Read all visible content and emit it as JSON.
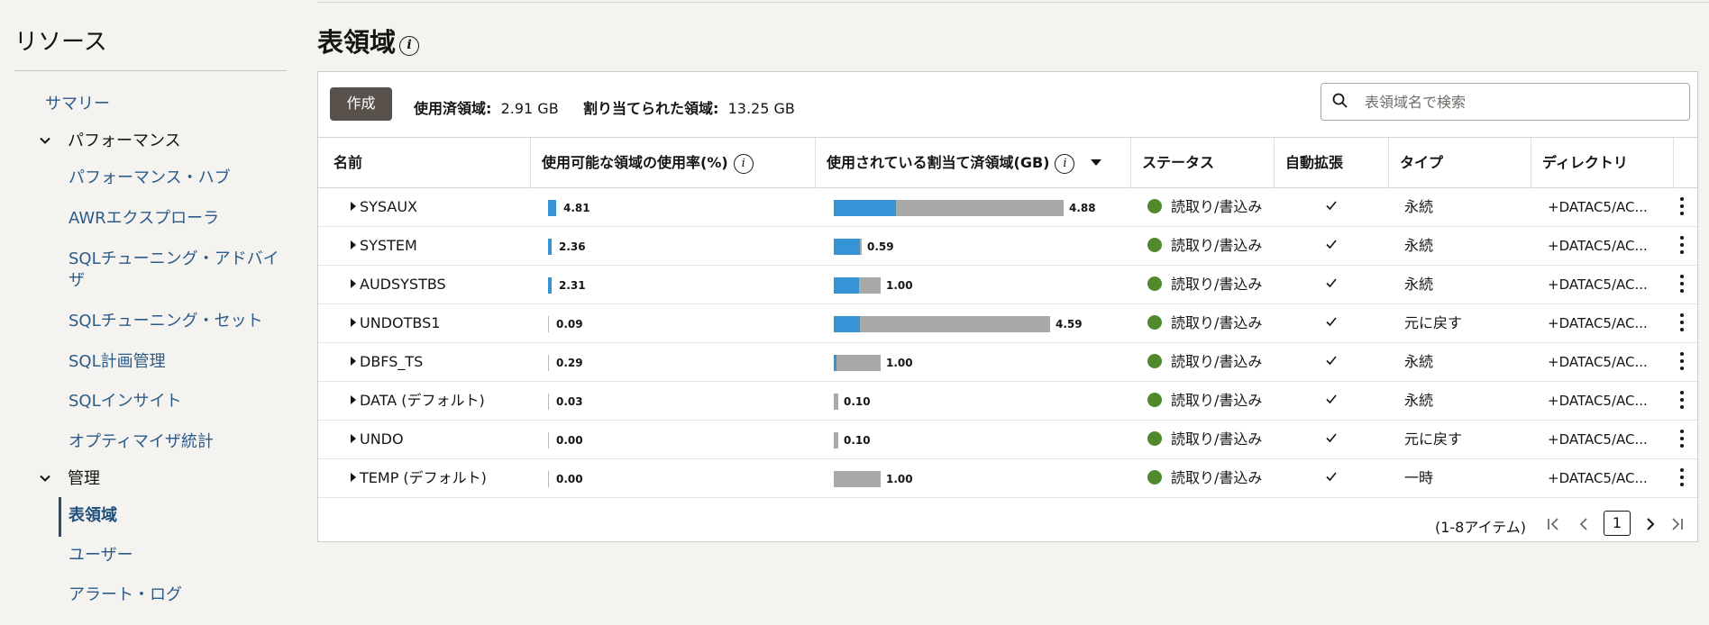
{
  "sidebar": {
    "title": "リソース",
    "items": [
      {
        "label": "サマリー"
      },
      {
        "label": "パフォーマンス"
      },
      {
        "label": "パフォーマンス・ハブ"
      },
      {
        "label": "AWRエクスプローラ"
      },
      {
        "label": "SQLチューニング・アドバイ"
      },
      {
        "label": "ザ"
      },
      {
        "label": "SQLチューニング・セット"
      },
      {
        "label": "SQL計画管理"
      },
      {
        "label": "SQLインサイト"
      },
      {
        "label": "オプティマイザ統計"
      },
      {
        "label": "管理"
      },
      {
        "label": "表領域"
      },
      {
        "label": "ユーザー"
      },
      {
        "label": "アラート・ログ"
      }
    ]
  },
  "page": {
    "title": "表領域",
    "info_glyph": "i"
  },
  "toolbar": {
    "create_label": "作成",
    "used_label": "使用済領域:",
    "used_value": "2.91 GB",
    "allocated_label": "割り当てられた領域:",
    "allocated_value": "13.25 GB",
    "search_placeholder": "表領域名で検索"
  },
  "columns": {
    "name": "名前",
    "usable_pct": "使用可能な領域の使用率(%)",
    "allocated_used": "使用されている割当て済領域(GB)",
    "status": "ステータス",
    "autoextend": "自動拡張",
    "type": "タイプ",
    "directory": "ディレクトリ"
  },
  "rows": [
    {
      "name": "SYSAUX",
      "pct": "4.81",
      "pct_num": 4.81,
      "used": "4.88",
      "used_frac": 0.27,
      "alloc_frac": 1.0,
      "status": "読取り/書込み",
      "type": "永続",
      "dir": "+DATAC5/AC..."
    },
    {
      "name": "SYSTEM",
      "pct": "2.36",
      "pct_num": 2.36,
      "used": "0.59",
      "used_frac": 0.92,
      "alloc_frac": 0.121,
      "status": "読取り/書込み",
      "type": "永続",
      "dir": "+DATAC5/AC..."
    },
    {
      "name": "AUDSYSTBS",
      "pct": "2.31",
      "pct_num": 2.31,
      "used": "1.00",
      "used_frac": 0.53,
      "alloc_frac": 0.205,
      "status": "読取り/書込み",
      "type": "永続",
      "dir": "+DATAC5/AC..."
    },
    {
      "name": "UNDOTBS1",
      "pct": "0.09",
      "pct_num": 0.09,
      "used": "4.59",
      "used_frac": 0.12,
      "alloc_frac": 0.94,
      "status": "読取り/書込み",
      "type": "元に戻す",
      "dir": "+DATAC5/AC..."
    },
    {
      "name": "DBFS_TS",
      "pct": "0.29",
      "pct_num": 0.29,
      "used": "1.00",
      "used_frac": 0.06,
      "alloc_frac": 0.205,
      "status": "読取り/書込み",
      "type": "永続",
      "dir": "+DATAC5/AC..."
    },
    {
      "name": "DATA (デフォルト)",
      "pct": "0.03",
      "pct_num": 0.03,
      "used": "0.10",
      "used_frac": 0.0,
      "alloc_frac": 0.021,
      "status": "読取り/書込み",
      "type": "永続",
      "dir": "+DATAC5/AC..."
    },
    {
      "name": "UNDO",
      "pct": "0.00",
      "pct_num": 0.0,
      "used": "0.10",
      "used_frac": 0.0,
      "alloc_frac": 0.021,
      "status": "読取り/書込み",
      "type": "元に戻す",
      "dir": "+DATAC5/AC..."
    },
    {
      "name": "TEMP (デフォルト)",
      "pct": "0.00",
      "pct_num": 0.0,
      "used": "1.00",
      "used_frac": 0.0,
      "alloc_frac": 0.205,
      "status": "読取り/書込み",
      "type": "一時",
      "dir": "+DATAC5/AC..."
    }
  ],
  "footer": {
    "count": "(1-8アイテム)",
    "page": "1"
  },
  "colors": {
    "accent_blue": "#3594d6",
    "status_green": "#508a2c",
    "allocated_gray": "#a9a9a9",
    "link": "#2c5b8a"
  },
  "icons": {
    "sort": "caret-down-icon",
    "expand": "caret-right-icon",
    "search": "search-icon",
    "check": "check-icon",
    "more": "kebab-icon",
    "first": "first-page-icon",
    "prev": "prev-page-icon",
    "next": "next-page-icon",
    "last": "last-page-icon"
  }
}
